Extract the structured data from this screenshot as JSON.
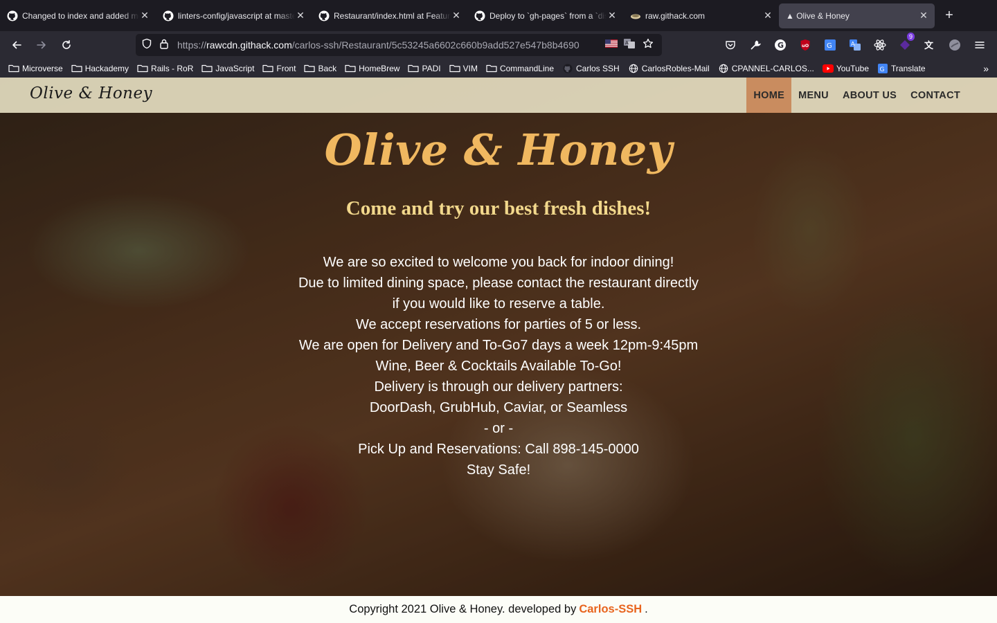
{
  "browser": {
    "tabs": [
      {
        "title": "Changed to index and added menu",
        "favicon": "github-icon",
        "active": false
      },
      {
        "title": "linters-config/javascript at master",
        "favicon": "github-icon",
        "active": false
      },
      {
        "title": "Restaurant/index.html at Feature",
        "favicon": "github-icon",
        "active": false
      },
      {
        "title": "Deploy to `gh-pages` from a `dist`",
        "favicon": "github-icon",
        "active": false
      },
      {
        "title": "raw.githack.com",
        "favicon": "githack-icon",
        "active": false
      },
      {
        "title": "▲ Olive & Honey",
        "favicon": "",
        "active": true
      }
    ],
    "url_host": "rawcdn.githack.com",
    "url_prefix": "https://",
    "url_path": "/carlos-ssh/Restaurant/5c53245a6602c660b9add527e547b8b4690",
    "extension_badge": "9",
    "bookmarks": [
      {
        "label": "Microverse",
        "icon": "folder-icon"
      },
      {
        "label": "Hackademy",
        "icon": "folder-icon"
      },
      {
        "label": "Rails - RoR",
        "icon": "folder-icon"
      },
      {
        "label": "JavaScript",
        "icon": "folder-icon"
      },
      {
        "label": "Front",
        "icon": "folder-icon"
      },
      {
        "label": "Back",
        "icon": "folder-icon"
      },
      {
        "label": "HomeBrew",
        "icon": "folder-icon"
      },
      {
        "label": "PADI",
        "icon": "folder-icon"
      },
      {
        "label": "VIM",
        "icon": "folder-icon"
      },
      {
        "label": "CommandLine",
        "icon": "folder-icon"
      },
      {
        "label": "Carlos SSH",
        "icon": "github-icon"
      },
      {
        "label": "CarlosRobles-Mail",
        "icon": "globe-icon"
      },
      {
        "label": "CPANNEL-CARLOS...",
        "icon": "globe-icon"
      },
      {
        "label": "YouTube",
        "icon": "youtube-icon"
      },
      {
        "label": "Translate",
        "icon": "translate-icon"
      }
    ]
  },
  "site": {
    "brand": "Olive & Honey",
    "nav": [
      {
        "label": "HOME",
        "active": true
      },
      {
        "label": "MENU",
        "active": false
      },
      {
        "label": "ABOUT US",
        "active": false
      },
      {
        "label": "CONTACT",
        "active": false
      }
    ],
    "hero_title": "Olive & Honey",
    "hero_subtitle": "Come and try our best fresh dishes!",
    "hero_lines": [
      "We are so excited to welcome you back for indoor dining!",
      "Due to limited dining space, please contact the restaurant directly",
      "if you would like to reserve a table.",
      "We accept reservations for parties of 5 or less.",
      "We are open for Delivery and To-Go7 days a week 12pm-9:45pm",
      "Wine, Beer & Cocktails Available To-Go!",
      "Delivery is through our delivery partners:",
      "DoorDash, GrubHub, Caviar, or Seamless",
      "- or -",
      "Pick Up and Reservations: Call 898-145-0000",
      "Stay Safe!"
    ],
    "footer_prefix": "Copyright 2021 Olive & Honey. developed by",
    "footer_author": "Carlos-SSH",
    "footer_suffix": ".",
    "colors": {
      "title": "#f0b860",
      "subtitle": "#f2d88c",
      "nav_active": "#c98c5f",
      "author_link": "#e8641e"
    }
  }
}
